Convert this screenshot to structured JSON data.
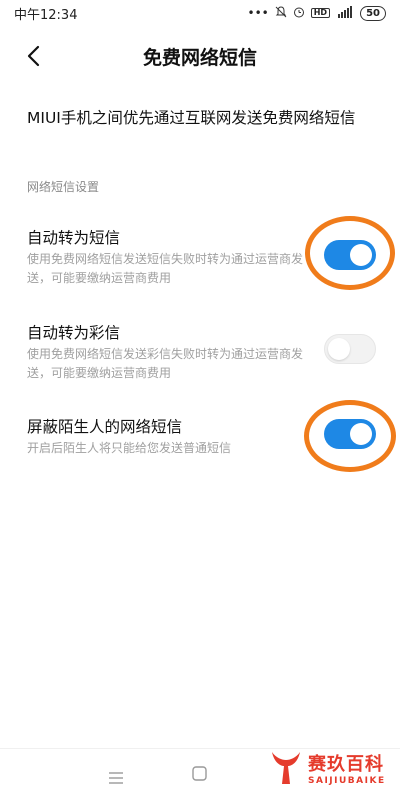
{
  "status_bar": {
    "time": "中午12:34",
    "signal_label": "4G",
    "battery": "50"
  },
  "header": {
    "title": "免费网络短信"
  },
  "intro": "MIUI手机之间优先通过互联网发送免费网络短信",
  "section_label": "网络短信设置",
  "settings": [
    {
      "title": "自动转为短信",
      "description": "使用免费网络短信发送短信失败时转为通过运营商发送，可能要缴纳运营商费用",
      "enabled": true
    },
    {
      "title": "自动转为彩信",
      "description": "使用免费网络短信发送彩信失败时转为通过运营商发送，可能要缴纳运营商费用",
      "enabled": false
    },
    {
      "title": "屏蔽陌生人的网络短信",
      "description": "开启后陌生人将只能给您发送普通短信",
      "enabled": true
    }
  ],
  "colors": {
    "toggle_on": "#1e88e5",
    "highlight": "#f07c1b",
    "watermark": "#e53b2c"
  },
  "watermark": {
    "name": "赛玖百科",
    "sub": "SAIJIUBAIKE"
  }
}
